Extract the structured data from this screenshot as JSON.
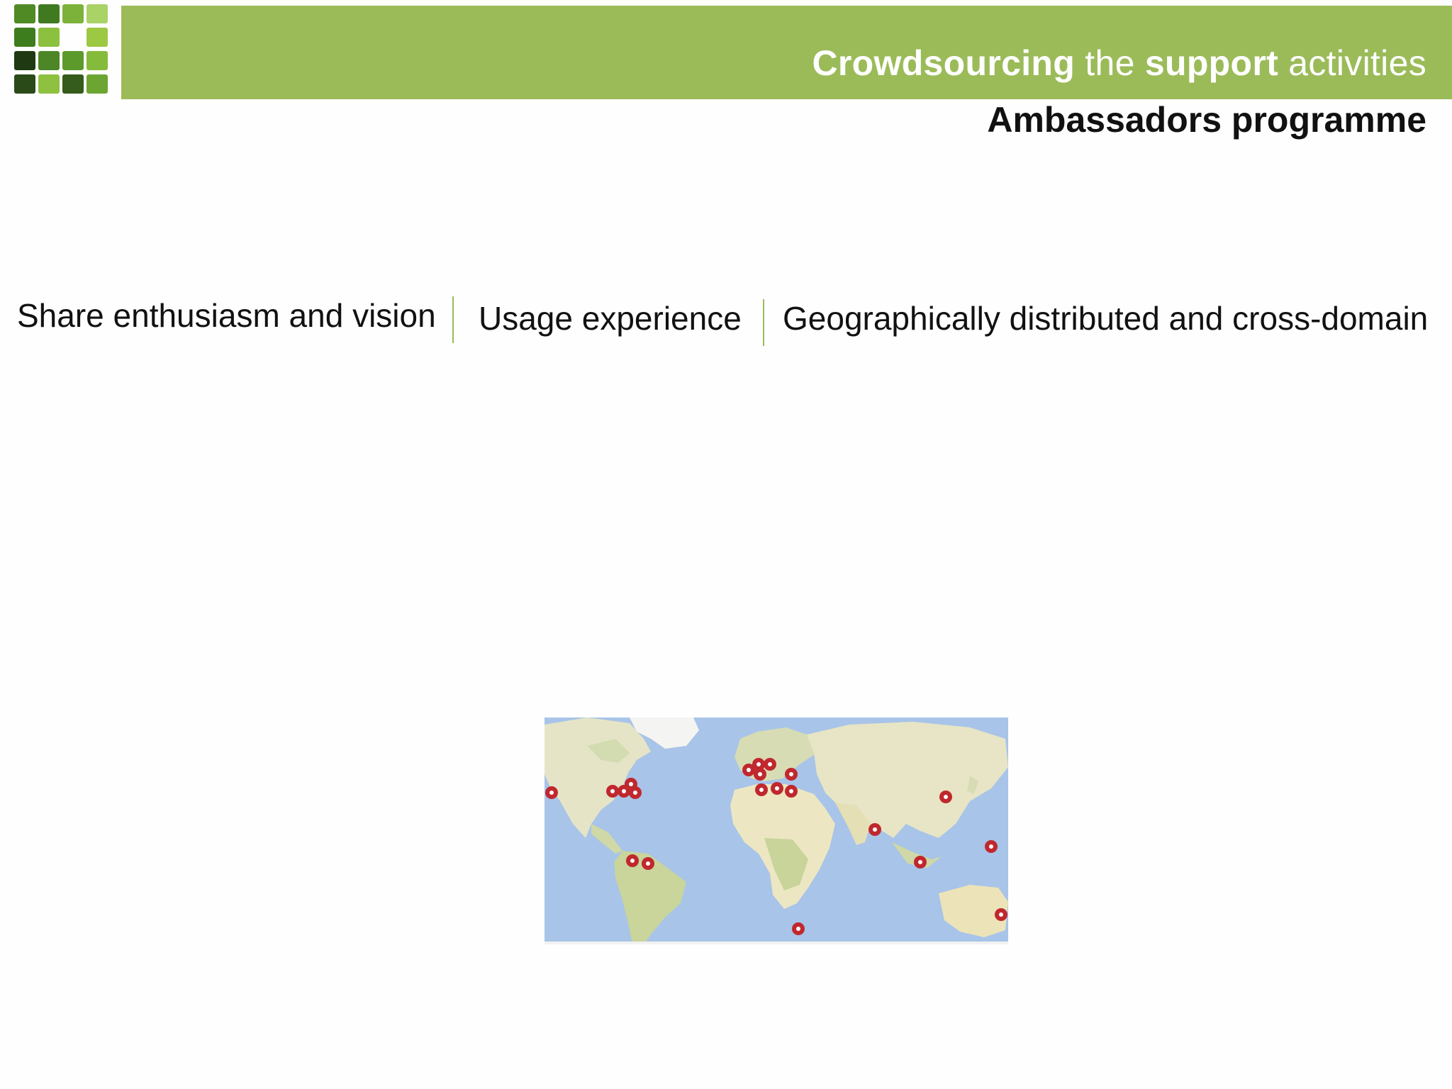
{
  "header": {
    "title_word_1": "Crowdsourcing",
    "title_word_2": " the ",
    "title_word_3": "support",
    "title_word_4": " activities",
    "subtitle": "Ambassadors programme",
    "band_color": "#9bbb59"
  },
  "pillars": [
    {
      "label": "Share enthusiasm and vision"
    },
    {
      "label": "Usage experience"
    },
    {
      "label": "Geographically distributed and cross-domain"
    }
  ],
  "map": {
    "name": "world-map",
    "ocean_color": "#a8c4e8",
    "land_color": "#e9e6c9",
    "pin_color": "#c0282d"
  }
}
